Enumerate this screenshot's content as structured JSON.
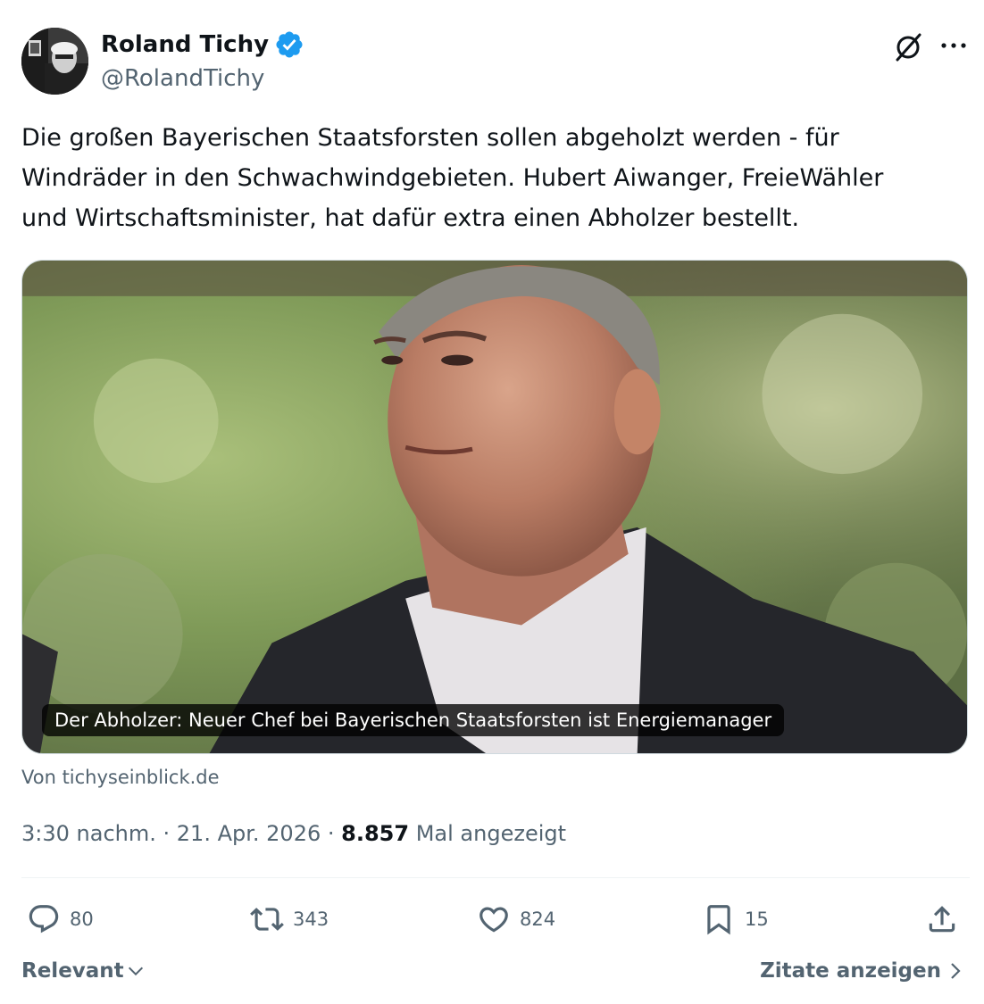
{
  "author": {
    "display_name": "Roland Tichy",
    "handle": "@RolandTichy",
    "verified": true,
    "avatar_icon": "profile-photo"
  },
  "tweet": {
    "text": "Die großen Bayerischen Staatsforsten sollen abgeholzt werden - für\nWindräder in den Schwachwindgebieten. Hubert Aiwanger, FreieWähler\nund Wirtschaftsminister, hat dafür extra einen Abholzer bestellt."
  },
  "media": {
    "caption": "Der Abholzer: Neuer Chef bei Bayerischen Staatsforsten ist Energiemanager",
    "source": "Von tichyseinblick.de"
  },
  "meta": {
    "time": "3:30 nachm.",
    "separator": "·",
    "date": "21. Apr. 2026",
    "views_count": "8.857",
    "views_label": "Mal angezeigt"
  },
  "actions": {
    "replies": "80",
    "reposts": "343",
    "likes": "824",
    "bookmarks": "15"
  },
  "footer": {
    "sort_label": "Relevant",
    "quotes_label": "Zitate anzeigen"
  },
  "colors": {
    "text_primary": "#0f1419",
    "text_secondary": "#536471",
    "verified_blue": "#1d9bf0",
    "divider": "#eff3f4"
  }
}
